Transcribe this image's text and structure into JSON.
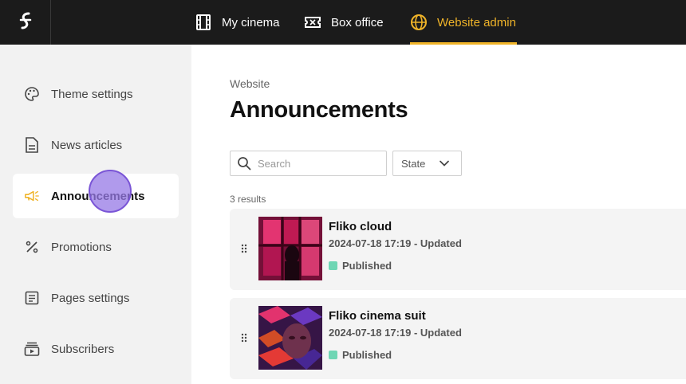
{
  "topbar": {
    "nav": [
      {
        "label": "My cinema",
        "icon": "film-icon"
      },
      {
        "label": "Box office",
        "icon": "ticket-icon"
      },
      {
        "label": "Website admin",
        "icon": "globe-icon"
      }
    ],
    "accent_color": "#f0b429"
  },
  "sidebar": {
    "items": [
      {
        "label": "Theme settings",
        "icon": "palette-icon"
      },
      {
        "label": "News articles",
        "icon": "document-icon"
      },
      {
        "label": "Announcements",
        "icon": "megaphone-icon"
      },
      {
        "label": "Promotions",
        "icon": "percent-icon"
      },
      {
        "label": "Pages settings",
        "icon": "pages-icon"
      },
      {
        "label": "Subscribers",
        "icon": "subscribers-icon"
      }
    ],
    "active": "Announcements"
  },
  "main": {
    "breadcrumb": "Website",
    "title": "Announcements",
    "search": {
      "placeholder": "Search",
      "value": ""
    },
    "state_filter": {
      "label": "State"
    },
    "results_text": "3 results",
    "announcements": [
      {
        "title": "Fliko cloud",
        "date": "2024-07-18 17:19 - Updated",
        "status": "Published",
        "status_color": "#6fd6b4"
      },
      {
        "title": "Fliko cinema suit",
        "date": "2024-07-18 17:19 - Updated",
        "status": "Published",
        "status_color": "#6fd6b4"
      }
    ]
  }
}
